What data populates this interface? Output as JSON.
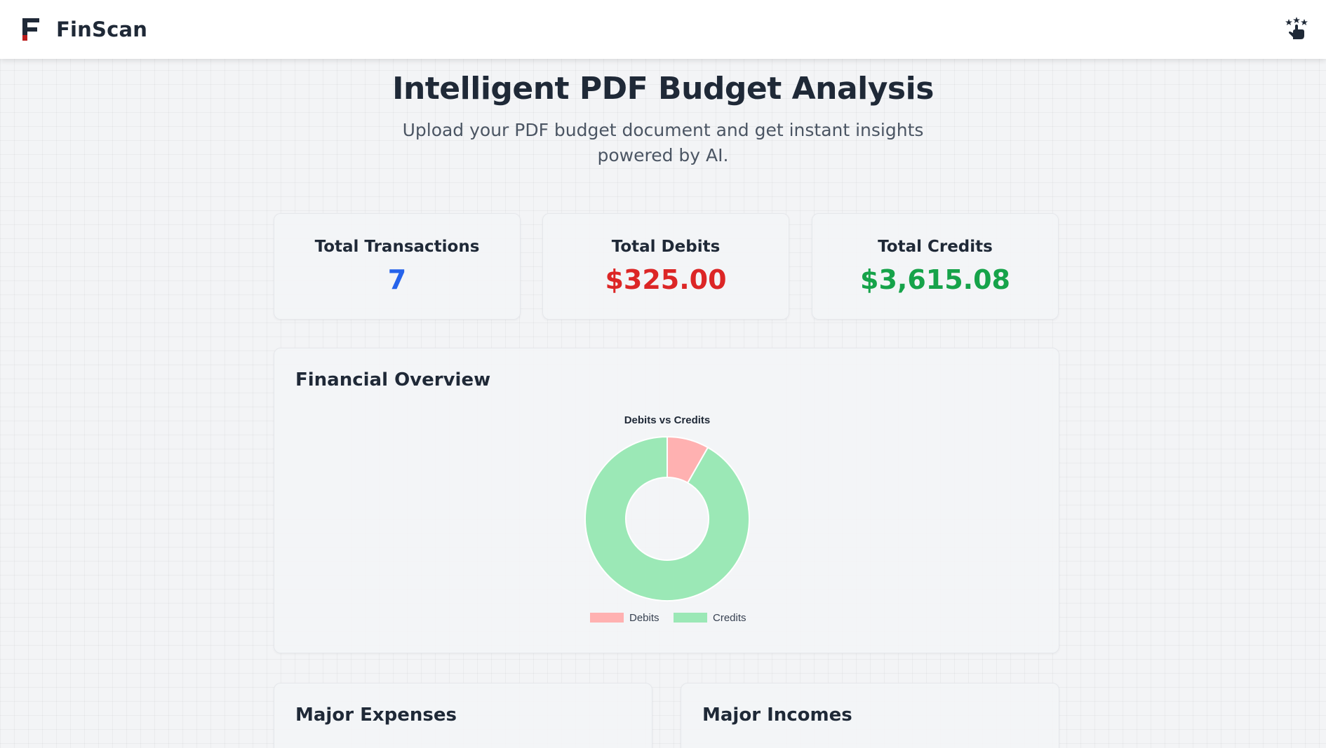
{
  "app": {
    "name": "FinScan"
  },
  "nav": {
    "action_icon": "sparkle-hand-icon"
  },
  "hero": {
    "title": "Intelligent PDF Budget Analysis",
    "subtitle": "Upload your PDF budget document and get instant insights powered by AI."
  },
  "stats": [
    {
      "label": "Total Transactions",
      "value": "7",
      "color": "#2563eb"
    },
    {
      "label": "Total Debits",
      "value": "$325.00",
      "color": "#dc2626"
    },
    {
      "label": "Total Credits",
      "value": "$3,615.08",
      "color": "#16a34a"
    }
  ],
  "overview": {
    "title": "Financial Overview"
  },
  "chart_data": {
    "type": "pie",
    "variant": "doughnut",
    "title": "Debits vs Credits",
    "labels": [
      "Debits",
      "Credits"
    ],
    "values": [
      325.0,
      3615.08
    ],
    "colors": [
      "#ffb1b1",
      "#9be8b6"
    ],
    "legend_position": "bottom"
  },
  "sections": {
    "expenses_title": "Major Expenses",
    "incomes_title": "Major Incomes"
  },
  "colors": {
    "accent_blue": "#2563eb",
    "debit_red": "#dc2626",
    "credit_green": "#16a34a"
  }
}
